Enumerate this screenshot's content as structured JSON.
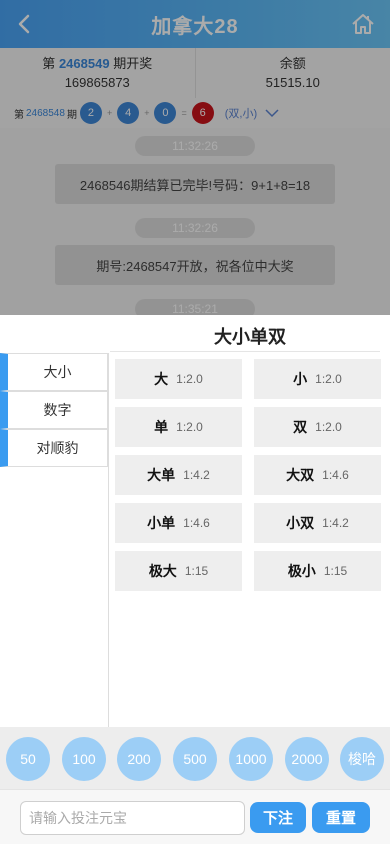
{
  "header": {
    "title": "加拿大28"
  },
  "info": {
    "period_prefix": "第",
    "period_number": "2468549",
    "period_suffix": "期开奖",
    "countdown": "169865873",
    "balance_label": "余额",
    "balance_value": "51515.10"
  },
  "last_draw": {
    "prefix": "第",
    "period": "2468548",
    "suffix": "期",
    "balls": [
      "2",
      "4",
      "0",
      "6"
    ],
    "plus": "+",
    "equals": "=",
    "attr": "(双,小)"
  },
  "chat": {
    "messages": [
      {
        "time": "11:32:26",
        "text": "2468546期结算已完毕!号码：9+1+8=18"
      },
      {
        "time": "11:32:26",
        "text": "期号:2468547开放，祝各位中大奖"
      },
      {
        "time": "11:35:21"
      }
    ]
  },
  "panel": {
    "title": "大小单双",
    "tabs": [
      "大小",
      "数字",
      "对顺豹"
    ],
    "options": [
      {
        "name": "大",
        "odds": "1:2.0"
      },
      {
        "name": "小",
        "odds": "1:2.0"
      },
      {
        "name": "单",
        "odds": "1:2.0"
      },
      {
        "name": "双",
        "odds": "1:2.0"
      },
      {
        "name": "大单",
        "odds": "1:4.2"
      },
      {
        "name": "大双",
        "odds": "1:4.6"
      },
      {
        "name": "小单",
        "odds": "1:4.6"
      },
      {
        "name": "小双",
        "odds": "1:4.2"
      },
      {
        "name": "极大",
        "odds": "1:15"
      },
      {
        "name": "极小",
        "odds": "1:15"
      }
    ]
  },
  "chips": [
    "50",
    "100",
    "200",
    "500",
    "1000",
    "2000",
    "梭哈"
  ],
  "bottom": {
    "placeholder": "请输入投注元宝",
    "submit_label": "下注",
    "reset_label": "重置"
  },
  "colors": {
    "accent": "#3a9bf0",
    "ball_blue": "#3e86d6",
    "ball_red": "#c8141c"
  }
}
